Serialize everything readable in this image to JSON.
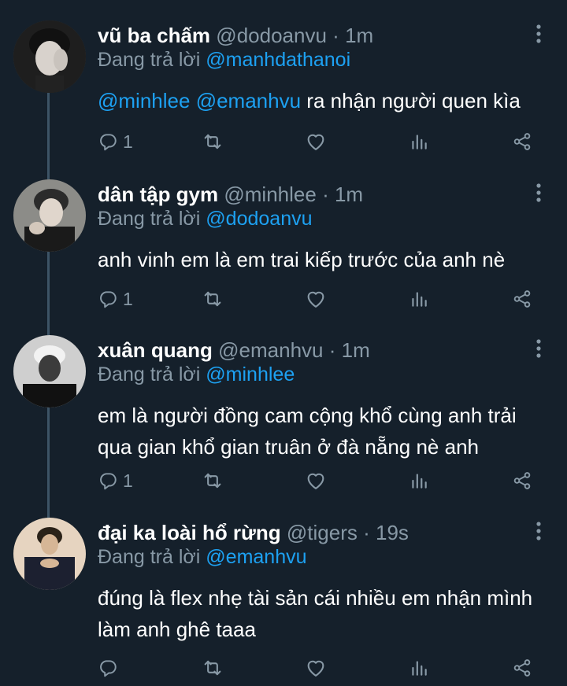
{
  "colors": {
    "background": "#15202b",
    "accent": "#1da1f2",
    "muted": "#8899a6",
    "text": "#ffffff"
  },
  "tweets": [
    {
      "name": "vũ ba chấm",
      "handle": "@dodoanvu",
      "time": "1m",
      "reply_prefix": "Đang trả lời",
      "reply_to": "@manhdathanoi",
      "mentions": [
        "@minhlee",
        "@emanhvu"
      ],
      "text": "ra nhận người quen kìa",
      "reply_count": "1",
      "icons": [
        "reply-icon",
        "retweet-icon",
        "like-icon",
        "analytics-icon",
        "share-icon",
        "more-icon"
      ]
    },
    {
      "name": "dân tập gym",
      "handle": "@minhlee",
      "time": "1m",
      "reply_prefix": "Đang trả lời",
      "reply_to": "@dodoanvu",
      "text": "anh vinh em là em trai kiếp trước của anh nè",
      "reply_count": "1"
    },
    {
      "name": "xuân quang",
      "handle": "@emanhvu",
      "time": "1m",
      "reply_prefix": "Đang trả lời",
      "reply_to": "@minhlee",
      "text": "em là người đồng cam cộng khổ cùng anh trải qua gian khổ gian truân ở đà nẵng nè anh",
      "reply_count": "1"
    },
    {
      "name": "đại ka loài hổ rừng",
      "handle": "@tigers",
      "time": "19s",
      "reply_prefix": "Đang trả lời",
      "reply_to": "@emanhvu",
      "text": "đúng là flex nhẹ tài sản cái nhiều em nhận mình làm anh ghê taaa",
      "reply_count": ""
    }
  ]
}
